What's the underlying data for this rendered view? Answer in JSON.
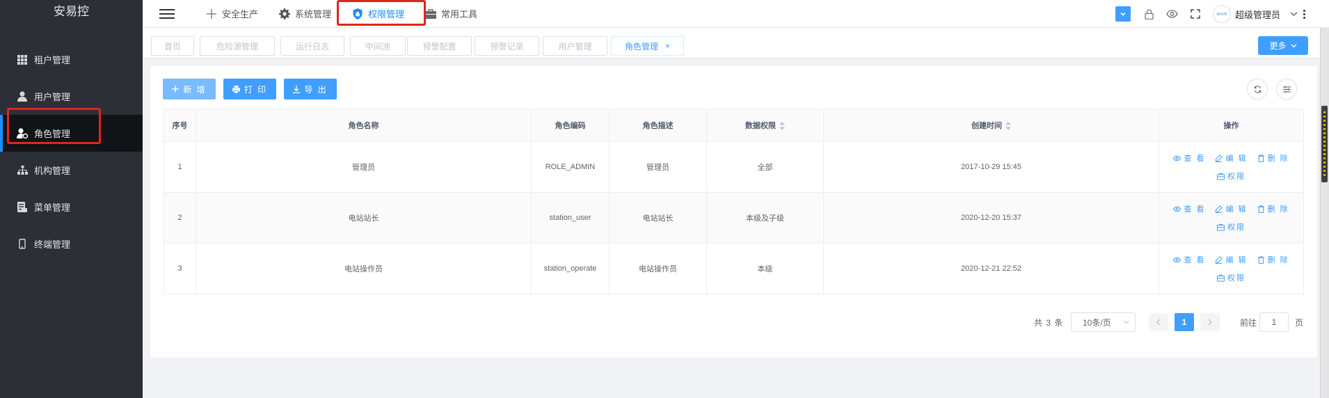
{
  "app": {
    "brand": "安易控"
  },
  "sidebar": {
    "items": [
      {
        "label": "租户管理",
        "icon": "grid-icon"
      },
      {
        "label": "用户管理",
        "icon": "user-icon"
      },
      {
        "label": "角色管理",
        "icon": "user-role-icon",
        "active": true
      },
      {
        "label": "机构管理",
        "icon": "org-tree-icon"
      },
      {
        "label": "菜单管理",
        "icon": "menu-list-icon"
      },
      {
        "label": "终端管理",
        "icon": "mobile-icon"
      }
    ]
  },
  "topnav": {
    "items": [
      {
        "label": "安全生产",
        "icon": "plus-icon"
      },
      {
        "label": "系统管理",
        "icon": "gear-icon"
      },
      {
        "label": "权限管理",
        "icon": "shield-icon",
        "active": true
      },
      {
        "label": "常用工具",
        "icon": "briefcase-icon"
      }
    ],
    "user_name": "超级管理员",
    "avatar_text": "avue"
  },
  "tags": {
    "items": [
      "首页",
      "危险源管理",
      "运行日志",
      "中间池",
      "预警配置",
      "预警记录",
      "用户管理",
      "角色管理"
    ],
    "active_close": "×",
    "more_label": "更多"
  },
  "toolbar": {
    "add_label": "新 增",
    "print_label": "打 印",
    "export_label": "导 出"
  },
  "table": {
    "headers": [
      "序号",
      "角色名称",
      "角色编码",
      "角色描述",
      "数据权限",
      "创建时间",
      "操作"
    ],
    "rows": [
      {
        "index": "1",
        "name": "管理员",
        "code": "ROLE_ADMIN",
        "desc": "管理员",
        "scope": "全部",
        "created": "2017-10-29 15:45"
      },
      {
        "index": "2",
        "name": "电站站长",
        "code": "station_user",
        "desc": "电站站长",
        "scope": "本级及子级",
        "created": "2020-12-20 15:37"
      },
      {
        "index": "3",
        "name": "电站操作员",
        "code": "station_operate",
        "desc": "电站操作员",
        "scope": "本级",
        "created": "2020-12-21 22:52"
      }
    ],
    "actions": {
      "view": "查 看",
      "edit": "编 辑",
      "delete": "删 除",
      "permission": "权限"
    }
  },
  "pagination": {
    "total_text": "共 3 条",
    "page_size": "10条/页",
    "current_page": "1",
    "goto_label": "前往",
    "goto_value": "1",
    "page_suffix": "页"
  },
  "colors": {
    "primary": "#409eff",
    "sidebar_bg": "#2c2f36",
    "highlight": "#e0251b"
  }
}
